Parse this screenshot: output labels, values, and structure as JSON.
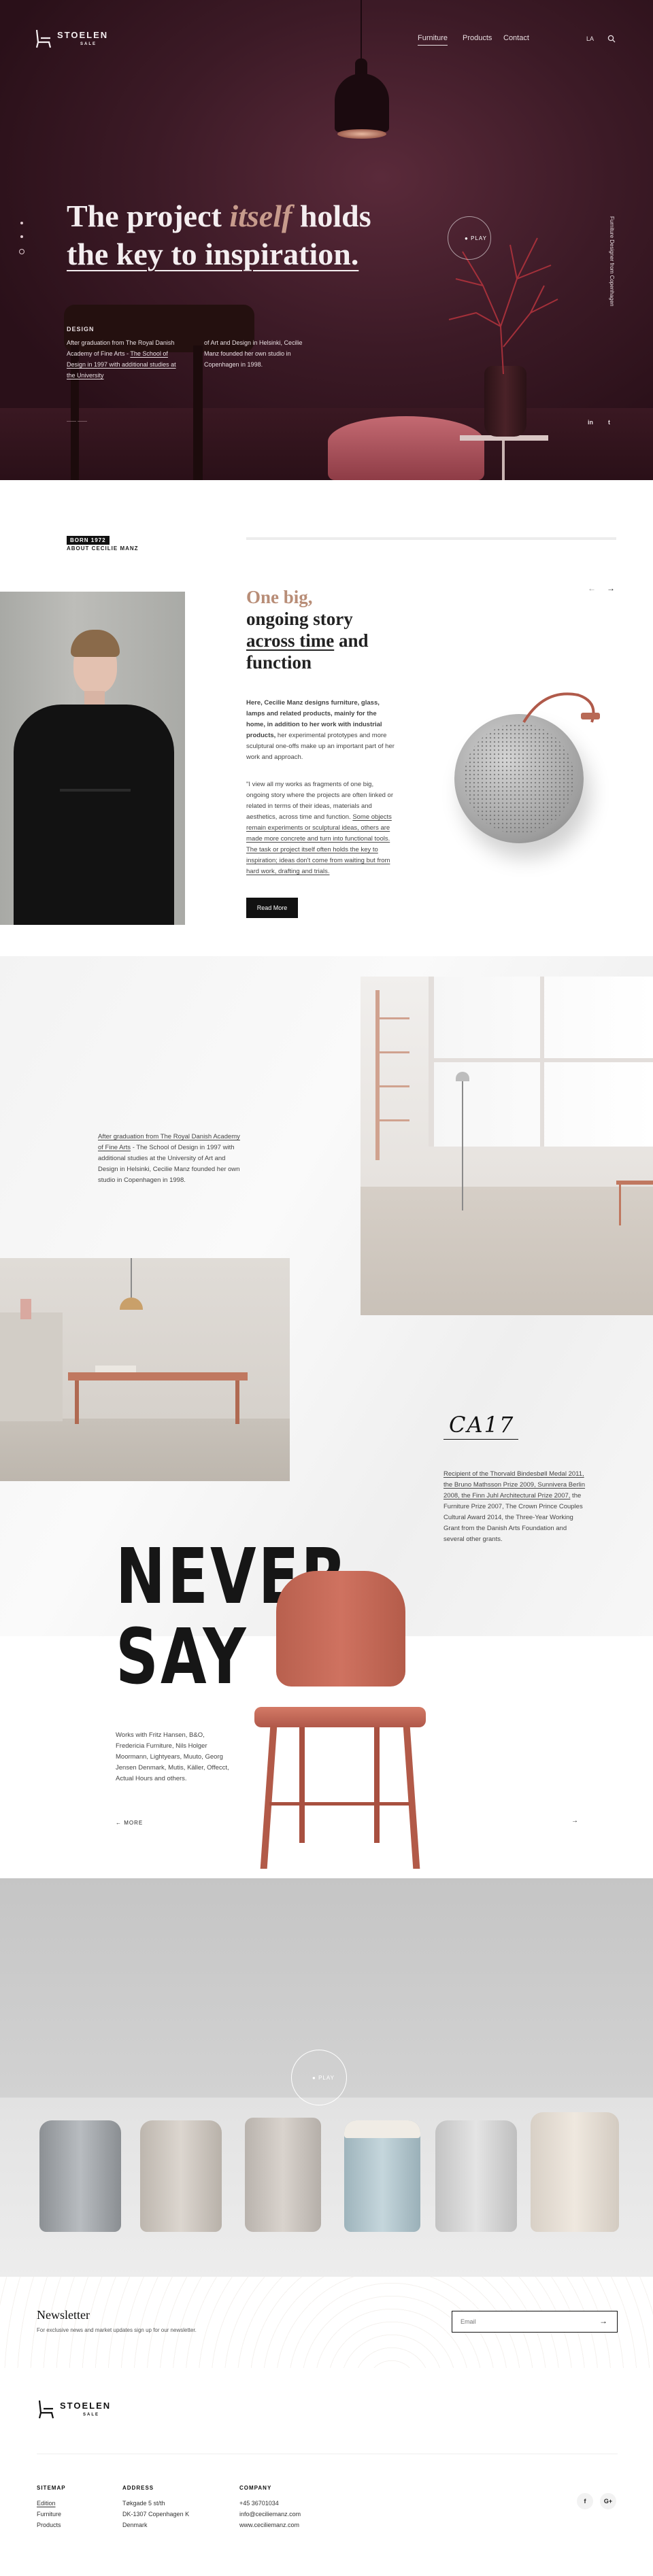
{
  "header": {
    "brand": "STOELEN",
    "brand_sub": "SALE",
    "nav": [
      "Furniture",
      "Products",
      "Contact"
    ],
    "lang": "LA",
    "colors": {
      "hero_bg": "#3c1a26",
      "accent": "#c79b8c"
    }
  },
  "hero": {
    "title_pre": "The project ",
    "title_em": "itself",
    "title_post": " holds",
    "title_line2": "the key to inspiration.",
    "label": "DESIGN",
    "col1_plain": "After graduation from The Royal Danish Academy of Fine Arts - ",
    "col1_link": "The School of Design in 1997 with additional studies at the University",
    "col2": "of Art and Design in Helsinki, Cecilie Manz founded her own studio in Copenhagen in 1998.",
    "play": "PLAY",
    "side_text": "Furniture Designer from Copenhagen",
    "social": [
      "in",
      "t"
    ],
    "scroll_hint": "—— ——"
  },
  "about": {
    "tag": "BORN 1972",
    "label": "ABOUT CECILIE MANZ",
    "title_accent": "One big,",
    "title_1": "ongoing story",
    "title_ul": "across time",
    "title_2": " and function",
    "p1_bold": "Here, Cecilie Manz designs furniture, glass, lamps and related products, mainly for the home, in addition to her work with industrial products,",
    "p1_rest": " her experimental prototypes and more sculptural one-offs make up an important part of her work and approach.",
    "p2_plain": "\"I view all my works as fragments of one big, ongoing story where the projects are often linked or related in terms of their ideas, materials and aesthetics, across time and function. ",
    "p2_link": "Some objects remain experiments or sculptural ideas, others are made more concrete and turn into functional tools. The task or project itself often holds the key to inspiration; ideas don't come from waiting but from hard work, drafting and trials.",
    "button": "Read More",
    "arrows": [
      "←",
      "→"
    ]
  },
  "gallery": {
    "text_link": "After graduation from The Royal Danish Academy of Fine Arts",
    "text_rest": " - The School of Design in 1997 with additional studies at the University of Art and Design in Helsinki, Cecilie Manz founded her own studio in Copenhagen in 1998.",
    "signature": "CA17",
    "award_link": "Recipient of the Thorvald Bindesbøll Medal 2011, the Bruno Mathsson Prize 2009, Sunnivera Berlin 2008, the Finn Juhl Architectural Prize 2007,",
    "award_rest": " the Furniture Prize 2007, The Crown Prince Couples Cultural Award 2014, the Three-Year Working Grant from the Danish Arts Foundation and several other grants."
  },
  "never": {
    "line1": "NEVER",
    "line2": "SAY",
    "text": "Works with Fritz Hansen, B&O, Fredericia Furniture, Nils Holger Moormann, Lightyears, Muuto, Georg Jensen Denmark, Mutis, Käller, Offecct, Actual Hours and others.",
    "link_left": "← MORE",
    "link_right": "→"
  },
  "video": {
    "play": "PLAY"
  },
  "newsletter": {
    "title": "Newsletter",
    "subtitle": "For exclusive news and market updates sign up for our newsletter.",
    "placeholder": "Email",
    "submit": "→"
  },
  "footer": {
    "sitemap": {
      "head": "SITEMAP",
      "items": [
        "Edition",
        "Furniture",
        "Products"
      ]
    },
    "address": {
      "head": "ADDRESS",
      "items": [
        "Tøkgade 5 st/th",
        "DK-1307 Copenhagen K",
        "Denmark"
      ]
    },
    "company": {
      "head": "COMPANY",
      "items": [
        "+45 36701034",
        "info@ceciliemanz.com",
        "www.ceciliemanz.com"
      ]
    },
    "social": [
      "f",
      "G+"
    ]
  }
}
